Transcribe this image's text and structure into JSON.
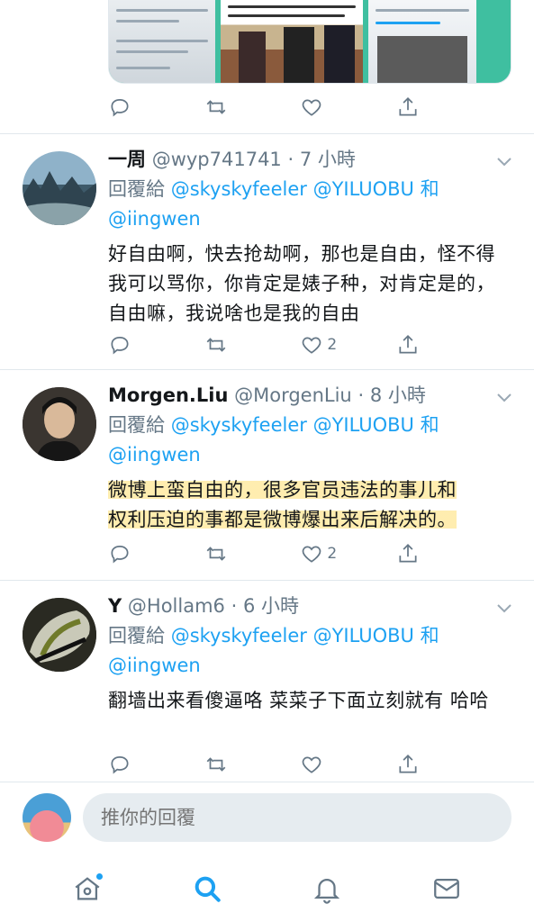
{
  "tweets": [
    {
      "name": "一周",
      "handle": "@wyp741741",
      "time": "7 小時",
      "reply_prefix": "回覆給",
      "mention1": "@skyskyfeeler",
      "mention2": "@YILUOBU",
      "and": "和",
      "mention3": "@iingwen",
      "text": "好自由啊，快去抢劫啊，那也是自由，怪不得我可以骂你，你肯定是婊子种，对肯定是的，自由嘛，我说啥也是我的自由",
      "likes": "2"
    },
    {
      "name": "Morgen.Liu",
      "handle": "@MorgenLiu",
      "time": "8 小時",
      "reply_prefix": "回覆給",
      "mention1": "@skyskyfeeler",
      "mention2": "@YILUOBU",
      "and": "和",
      "mention3": "@iingwen",
      "text_line1": "微博上蛮自由的，很多官员违法的事儿和",
      "text_line2": "权利压迫的事都是微博爆出来后解决的。",
      "likes": "2"
    },
    {
      "name": "Y",
      "handle": "@Hollam6",
      "time": "6 小時",
      "reply_prefix": "回覆給",
      "mention1": "@skyskyfeeler",
      "mention2": "@YILUOBU",
      "and": "和",
      "mention3": "@iingwen",
      "text": "翻墙出来看傻逼咯 菜菜子下面立刻就有 哈哈",
      "likes": ""
    }
  ],
  "dot": "·",
  "composer": {
    "placeholder": "推你的回覆"
  },
  "colors": {
    "accent": "#1da1f2",
    "muted": "#657786",
    "divider": "#e1e8ed",
    "highlight": "#ffde6e"
  },
  "icons": {
    "actions": [
      "reply-icon",
      "retweet-icon",
      "like-icon",
      "share-icon"
    ],
    "tabs": [
      "home-icon",
      "search-icon",
      "notifications-icon",
      "messages-icon"
    ]
  }
}
